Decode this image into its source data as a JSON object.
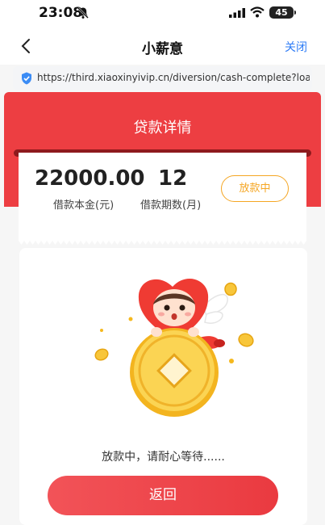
{
  "status_bar": {
    "time": "23:08",
    "battery": "45"
  },
  "nav": {
    "title": "小薪意",
    "close_label": "关闭"
  },
  "url_bar": {
    "url": "https://third.xiaoxinyivip.cn/diversion/cash-complete?loanT..."
  },
  "loan": {
    "page_title": "贷款详情",
    "amount": "22000.00",
    "amount_label": "借款本金(元)",
    "term": "12",
    "term_label": "借款期数(月)",
    "status": "放款中"
  },
  "result": {
    "wait_text": "放款中，请耐心等待......",
    "return_label": "返回"
  },
  "colors": {
    "brand_red": "#ed3e42",
    "accent_orange": "#f5a623",
    "link_blue": "#2e7cf6"
  }
}
